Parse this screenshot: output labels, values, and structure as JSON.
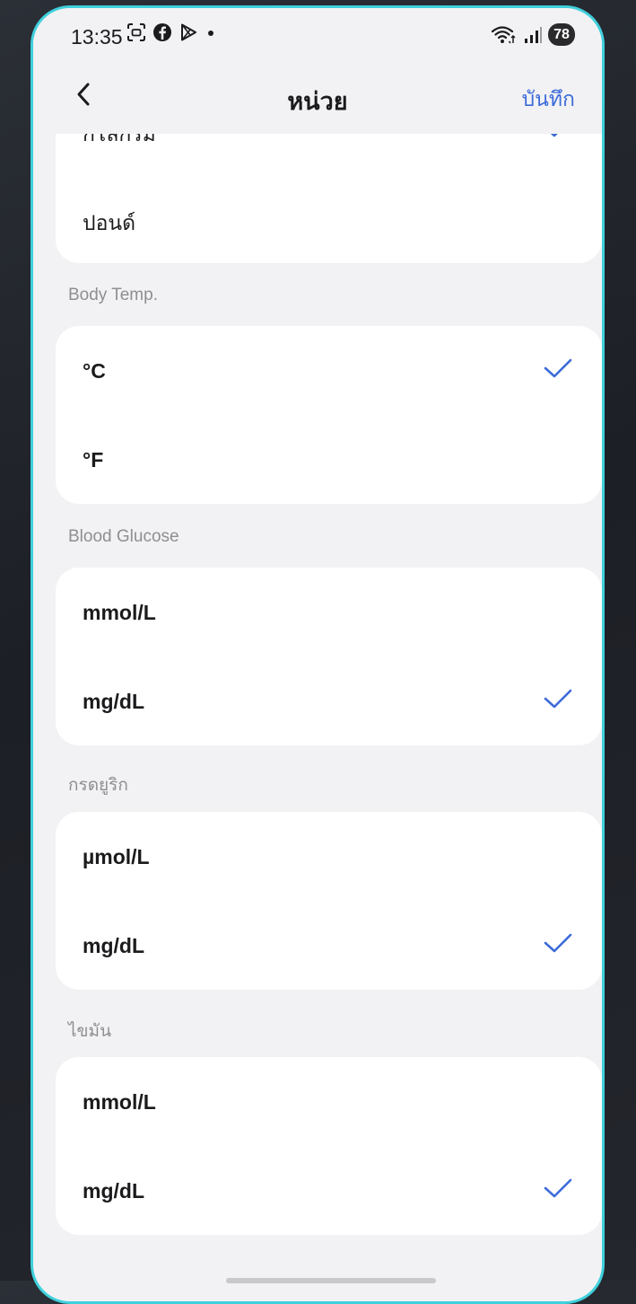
{
  "status_bar": {
    "time": "13:35",
    "battery": "78",
    "icons": [
      "screenshot-icon",
      "facebook-icon",
      "play-store-icon",
      "notification-dot-icon",
      "wifi-icon",
      "signal-icon"
    ]
  },
  "header": {
    "title": "หน่วย",
    "save_label": "บันทึก",
    "back_icon": "chevron-left-icon"
  },
  "weight_group": {
    "options": [
      {
        "label": "กิโลกรัม",
        "selected": true
      },
      {
        "label": "ปอนด์",
        "selected": false
      }
    ]
  },
  "body_temp": {
    "label": "Body Temp.",
    "options": [
      {
        "label": "°C",
        "selected": true
      },
      {
        "label": "°F",
        "selected": false
      }
    ]
  },
  "blood_glucose": {
    "label": "Blood Glucose",
    "options": [
      {
        "label": "mmol/L",
        "selected": false
      },
      {
        "label": "mg/dL",
        "selected": true
      }
    ]
  },
  "uric_acid": {
    "label": "กรดยูริก",
    "options": [
      {
        "label": "µmol/L",
        "selected": false
      },
      {
        "label": "mg/dL",
        "selected": true
      }
    ]
  },
  "lipid": {
    "label": "ไขมัน",
    "options": [
      {
        "label": "mmol/L",
        "selected": false
      },
      {
        "label": "mg/dL",
        "selected": true
      }
    ]
  },
  "colors": {
    "accent": "#3d6bd9",
    "background": "#f2f2f4",
    "card": "#ffffff",
    "frame": "#3fd0dc",
    "section_label": "#8e8e93"
  }
}
